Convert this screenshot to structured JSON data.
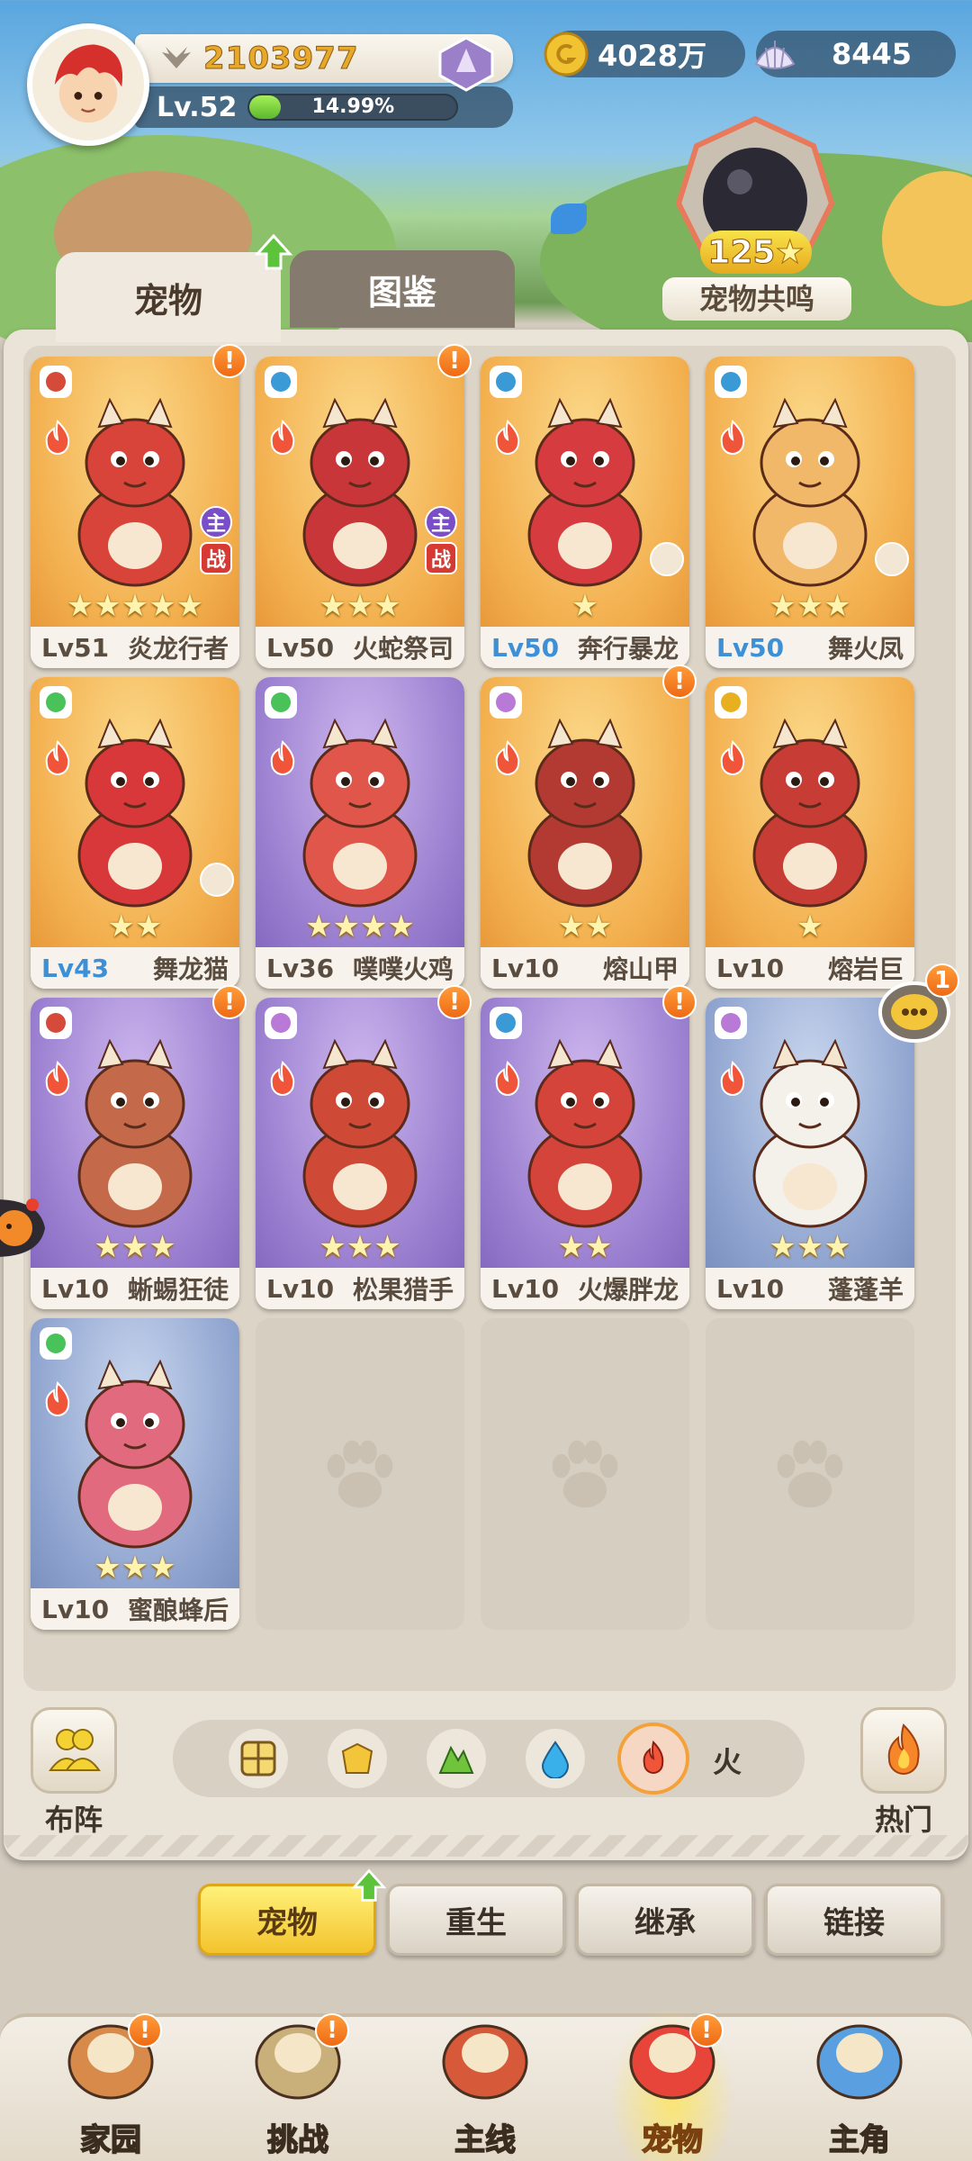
{
  "player": {
    "power": "2103977",
    "level": "Lv.52",
    "exp_percent": "14.99%",
    "exp_fraction": 0.1499
  },
  "currencies": {
    "gold": "4028万",
    "shells": "8445"
  },
  "resonance": {
    "count": "125",
    "label": "宠物共鸣"
  },
  "tabs": {
    "pets": "宠物",
    "dex": "图鉴"
  },
  "pets": [
    {
      "level": "Lv51",
      "name": "炎龙行者",
      "stars": "★★★★★",
      "bg": "orange",
      "alert": true,
      "main": "主",
      "battle": "战",
      "color": "#d8443a",
      "level_highlight": false
    },
    {
      "level": "Lv50",
      "name": "火蛇祭司",
      "stars": "★★★",
      "bg": "orange",
      "alert": true,
      "main": "主",
      "battle": "战",
      "color": "#c9363a",
      "level_highlight": false
    },
    {
      "level": "Lv50",
      "name": "奔行暴龙",
      "stars": "★",
      "bg": "orange",
      "alert": false,
      "color": "#d63b3f",
      "level_highlight": true
    },
    {
      "level": "Lv50",
      "name": "舞火凤",
      "stars": "★★★",
      "bg": "orange",
      "alert": false,
      "color": "#f2b86a",
      "level_highlight": true
    },
    {
      "level": "Lv43",
      "name": "舞龙猫",
      "stars": "★★",
      "bg": "orange",
      "alert": false,
      "color": "#d8383a",
      "level_highlight": true
    },
    {
      "level": "Lv36",
      "name": "噗噗火鸡",
      "stars": "★★★★",
      "bg": "purple",
      "alert": false,
      "color": "#e0564a",
      "level_highlight": false
    },
    {
      "level": "Lv10",
      "name": "熔山甲",
      "stars": "★★",
      "bg": "orange",
      "alert": true,
      "color": "#b23a32",
      "level_highlight": false
    },
    {
      "level": "Lv10",
      "name": "熔岩巨",
      "stars": "★",
      "bg": "orange",
      "alert": false,
      "color": "#c83c36",
      "level_highlight": false
    },
    {
      "level": "Lv10",
      "name": "蜥蜴狂徒",
      "stars": "★★★",
      "bg": "purple",
      "alert": true,
      "color": "#c46a4a",
      "level_highlight": false
    },
    {
      "level": "Lv10",
      "name": "松果猎手",
      "stars": "★★★",
      "bg": "purple",
      "alert": true,
      "color": "#cf4a36",
      "level_highlight": false
    },
    {
      "level": "Lv10",
      "name": "火爆胖龙",
      "stars": "★★",
      "bg": "purple",
      "alert": true,
      "color": "#d4443a",
      "level_highlight": false
    },
    {
      "level": "Lv10",
      "name": "蓬蓬羊",
      "stars": "★★★",
      "bg": "blue",
      "alert": false,
      "color": "#f4f1ea",
      "level_highlight": false
    },
    {
      "level": "Lv10",
      "name": "蜜酿蜂后",
      "stars": "★★★",
      "bg": "blue",
      "alert": false,
      "color": "#e26a7e",
      "level_highlight": false
    }
  ],
  "filter": {
    "formation_label": "布阵",
    "hot_label": "热门",
    "active_element": "火"
  },
  "sub_actions": [
    "宠物",
    "重生",
    "继承",
    "链接"
  ],
  "nav": [
    {
      "label": "家园",
      "alert": true
    },
    {
      "label": "挑战",
      "alert": true
    },
    {
      "label": "主线",
      "alert": false
    },
    {
      "label": "宠物",
      "alert": true
    },
    {
      "label": "主角",
      "alert": false
    }
  ],
  "chat_badge": "1",
  "alert_mark": "!",
  "colors": {
    "accent_orange": "#f5a13a",
    "active_tab_yellow": "#f3c32d",
    "level_blue": "#3d8fd6"
  }
}
